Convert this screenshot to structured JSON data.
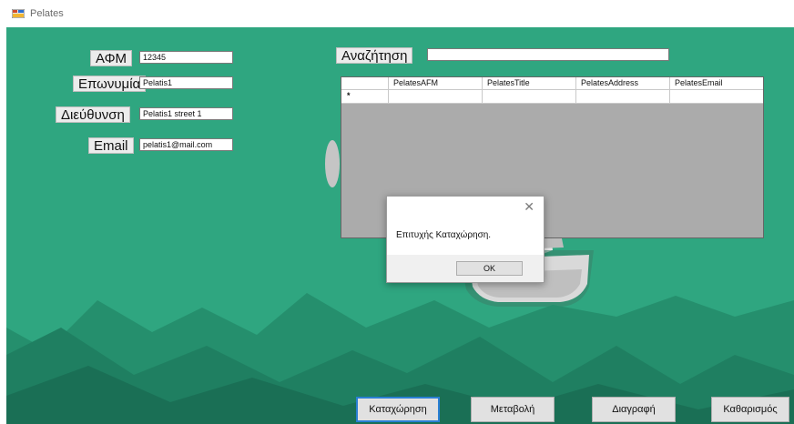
{
  "window": {
    "title": "Pelates",
    "icon": "form-icon"
  },
  "form": {
    "afm_label": "ΑΦΜ",
    "afm_value": "12345",
    "title_label": "Επωνυμία",
    "title_value": "Pelatis1",
    "address_label": "Διεύθυνση",
    "address_value": "Pelatis1 street 1",
    "email_label": "Email",
    "email_value": "pelatis1@mail.com"
  },
  "search": {
    "label": "Αναζήτηση",
    "value": ""
  },
  "grid": {
    "columns": [
      "PelatesAFM",
      "PelatesTitle",
      "PelatesAddress",
      "PelatesEmail"
    ],
    "new_row_marker": "*"
  },
  "dialog": {
    "message": "Επιτυχής Καταχώρηση.",
    "ok_label": "OK",
    "close_icon": "close-icon"
  },
  "buttons": {
    "insert": "Καταχώρηση",
    "update": "Μεταβολή",
    "delete": "Διαγραφή",
    "clear": "Καθαρισμός"
  },
  "colors": {
    "background": "#2fa680",
    "mountains_dark": "#1f7f61",
    "mountains_mid": "#258f6d",
    "grid_background": "#ababab",
    "focus_border": "#2a7fd4"
  }
}
